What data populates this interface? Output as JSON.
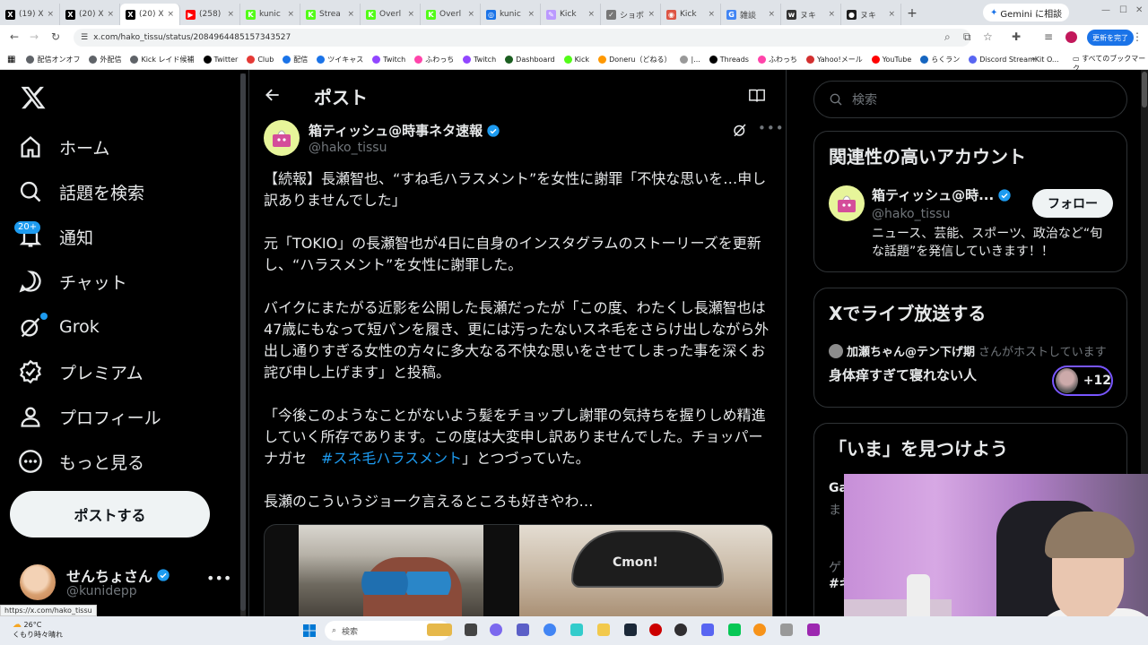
{
  "browser": {
    "tabs": [
      {
        "label": "(19) X",
        "color": "#000000",
        "glyph": "X"
      },
      {
        "label": "(20) X",
        "color": "#000000",
        "glyph": "X"
      },
      {
        "label": "(20) X",
        "color": "#000000",
        "glyph": "X",
        "active": true
      },
      {
        "label": "(258)",
        "color": "#ff0000",
        "glyph": "▶"
      },
      {
        "label": "kunic",
        "color": "#53fc18",
        "glyph": "K"
      },
      {
        "label": "Strea",
        "color": "#53fc18",
        "glyph": "K"
      },
      {
        "label": "Overl",
        "color": "#53fc18",
        "glyph": "K"
      },
      {
        "label": "Overl",
        "color": "#53fc18",
        "glyph": "K"
      },
      {
        "label": "kunic",
        "color": "#1a73e8",
        "glyph": "◎"
      },
      {
        "label": "Kick",
        "color": "#b9f",
        "glyph": "✎"
      },
      {
        "label": "ショボ",
        "color": "#777777",
        "glyph": "✓"
      },
      {
        "label": "Kick",
        "color": "#d54",
        "glyph": "◉"
      },
      {
        "label": "雑談",
        "color": "#4285f4",
        "glyph": "G"
      },
      {
        "label": "ヌキ",
        "color": "#333333",
        "glyph": "w"
      },
      {
        "label": "ヌキ",
        "color": "#1d1d1d",
        "glyph": "●"
      }
    ],
    "new_tab": "+",
    "gemini_label": "Gemini に相談",
    "url": "x.com/hako_tissu/status/2084964485157343527",
    "update_label": "更新を完了",
    "bookmarks": [
      {
        "label": "配信オンオフ",
        "color": "#5f6368"
      },
      {
        "label": "外配信",
        "color": "#5f6368"
      },
      {
        "label": "Kick レイド候補",
        "color": "#5f6368"
      },
      {
        "label": "Twitter",
        "color": "#000000"
      },
      {
        "label": "Club",
        "color": "#e53935"
      },
      {
        "label": "配信",
        "color": "#1a73e8"
      },
      {
        "label": "ツイキャス",
        "color": "#1a73e8"
      },
      {
        "label": "Twitch",
        "color": "#9146ff"
      },
      {
        "label": "ふわっち",
        "color": "#f4a"
      },
      {
        "label": "Twitch",
        "color": "#9146ff"
      },
      {
        "label": "Dashboard",
        "color": "#1b5e20"
      },
      {
        "label": "Kick",
        "color": "#53fc18"
      },
      {
        "label": "Doneru（どねる）",
        "color": "#ff9800"
      },
      {
        "label": "|...",
        "color": "#999999"
      },
      {
        "label": "Threads",
        "color": "#000000"
      },
      {
        "label": "ふわっち",
        "color": "#f4a"
      },
      {
        "label": "Yahoo!メール",
        "color": "#d32f2f"
      },
      {
        "label": "YouTube",
        "color": "#ff0000"
      },
      {
        "label": "らくラン",
        "color": "#1565c0"
      },
      {
        "label": "Discord StreamKit O...",
        "color": "#5865f2"
      }
    ],
    "all_bookmarks": "すべてのブックマーク",
    "status_url": "https://x.com/hako_tissu"
  },
  "nav": {
    "items": [
      {
        "label": "ホーム",
        "icon": "home-icon"
      },
      {
        "label": "話題を検索",
        "icon": "search-icon"
      },
      {
        "label": "通知",
        "icon": "bell-icon"
      },
      {
        "label": "チャット",
        "icon": "chat-icon"
      },
      {
        "label": "Grok",
        "icon": "grok-icon"
      },
      {
        "label": "プレミアム",
        "icon": "premium-icon"
      },
      {
        "label": "プロフィール",
        "icon": "profile-icon"
      },
      {
        "label": "もっと見る",
        "icon": "more-icon"
      }
    ],
    "notif_badge": "20+",
    "post_button": "ポストする",
    "account": {
      "name": "せんちょさん",
      "handle": "@kunidepp"
    }
  },
  "main": {
    "title": "ポスト",
    "author": {
      "name": "箱ティッシュ@時事ネタ速報",
      "handle": "@hako_tissu"
    },
    "paragraphs": [
      "【続報】長瀬智也、“すね毛ハラスメント”を女性に謝罪「不快な思いを…申し訳ありませんでした」",
      "元「TOKIO」の長瀬智也が4日に自身のインスタグラムのストーリーズを更新し、“ハラスメント”を女性に謝罪した。",
      "バイクにまたがる近影を公開した長瀬だったが「この度、わたくし長瀬智也は47歳にもなって短パンを履き、更には汚ったないスネ毛をさらけ出しながら外出し通りすぎる女性の方々に多大なる不快な思いをさせてしまった事を深くお詫び申し上げます」と投稿。"
    ],
    "quote_pre": "「今後このようなことがないよう髪をチョップし謝罪の気持ちを握りしめ精進していく所存であります。この度は大変申し訳ありませんでした。チョッパーナガセ　",
    "hashtag": "#スネ毛ハラスメント",
    "quote_post": "」とつづっていた。",
    "last_line": "長瀬のこういうジョーク言えるところも好きやわ…",
    "photo_cap_text": "Cmon!"
  },
  "right": {
    "search_placeholder": "検索",
    "related": {
      "title": "関連性の高いアカウント",
      "name": "箱ティッシュ@時...",
      "handle": "@hako_tissu",
      "follow": "フォロー",
      "bio": "ニュース、芸能、スポーツ、政治など“旬な話題”を発信していきます！！"
    },
    "live": {
      "title": "Xでライブ放送する",
      "host_name": "加瀬ちゃん@テン下げ期",
      "host_suffix": "さんがホストしています",
      "space_title": "身体痒すぎて寝れない人",
      "listeners": "+12"
    },
    "now": {
      "title": "「いま」を見つけよう",
      "partial": [
        "Ga",
        "ま",
        "ゲ",
        "#ギ"
      ]
    }
  },
  "taskbar": {
    "temp": "26°C",
    "weather": "くもり時々晴れ",
    "search": "検索"
  }
}
